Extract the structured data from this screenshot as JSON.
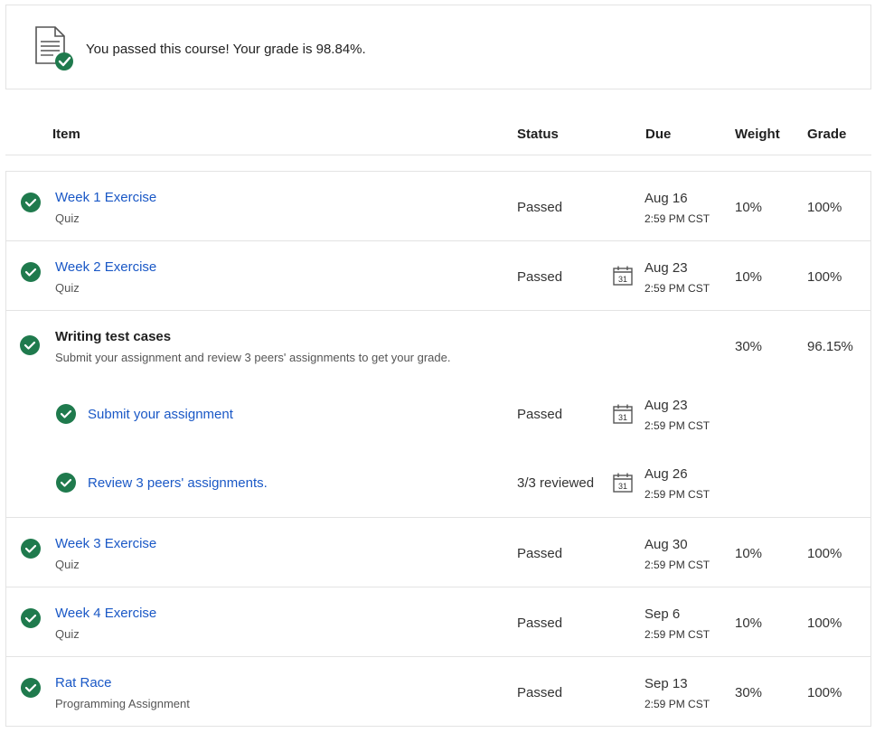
{
  "banner": {
    "message": "You passed this course! Your grade is 98.84%.",
    "icon": "document-check-icon"
  },
  "columns": {
    "item": "Item",
    "status": "Status",
    "due": "Due",
    "weight": "Weight",
    "grade": "Grade"
  },
  "colors": {
    "link": "#1a58c6",
    "success": "#1f7a4d",
    "border": "#e3e3e3"
  },
  "rows": [
    {
      "title": "Week 1 Exercise",
      "type": "Quiz",
      "status": "Passed",
      "due_date": "Aug 16",
      "due_time": "2:59 PM CST",
      "weight": "10%",
      "grade": "100%"
    },
    {
      "title": "Week 2 Exercise",
      "type": "Quiz",
      "status": "Passed",
      "due_date": "Aug 23",
      "due_time": "2:59 PM CST",
      "weight": "10%",
      "grade": "100%"
    },
    {
      "title": "Writing test cases",
      "description": "Submit your assignment and review 3 peers' assignments to get your grade.",
      "weight": "30%",
      "grade": "96.15%",
      "subitems": [
        {
          "title": "Submit your assignment",
          "status": "Passed",
          "due_date": "Aug 23",
          "due_time": "2:59 PM CST"
        },
        {
          "title": "Review 3 peers' assignments.",
          "status": "3/3 reviewed",
          "due_date": "Aug 26",
          "due_time": "2:59 PM CST"
        }
      ]
    },
    {
      "title": "Week 3 Exercise",
      "type": "Quiz",
      "status": "Passed",
      "due_date": "Aug 30",
      "due_time": "2:59 PM CST",
      "weight": "10%",
      "grade": "100%"
    },
    {
      "title": "Week 4 Exercise",
      "type": "Quiz",
      "status": "Passed",
      "due_date": "Sep 6",
      "due_time": "2:59 PM CST",
      "weight": "10%",
      "grade": "100%"
    },
    {
      "title": "Rat Race",
      "type": "Programming Assignment",
      "status": "Passed",
      "due_date": "Sep 13",
      "due_time": "2:59 PM CST",
      "weight": "30%",
      "grade": "100%"
    }
  ],
  "calendar_icon_label": "31"
}
